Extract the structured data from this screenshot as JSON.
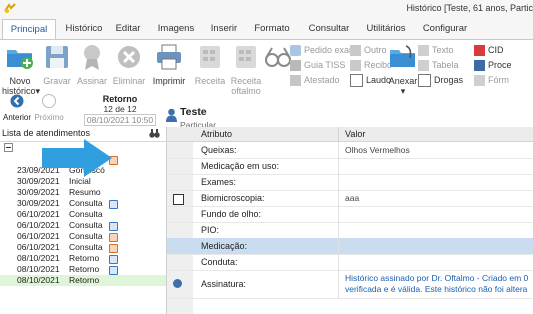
{
  "window": {
    "title": "Histórico [Teste, 61 anos, Partic"
  },
  "tabs": [
    "Principal",
    "Histórico",
    "Editar",
    "Imagens",
    "Inserir",
    "Formato",
    "Consultar",
    "Utilitários",
    "Configurar"
  ],
  "ribbon": {
    "novo": "Novo",
    "historico": "histórico",
    "gravar": "Gravar",
    "assinar": "Assinar",
    "eliminar": "Eliminar",
    "imprimir": "Imprimir",
    "receita": "Receita",
    "receita_oftalmo_1": "Receita",
    "receita_oftalmo_2": "oftalmo",
    "pedido_exame": "Pedido exam",
    "outro": "Outro",
    "guia_tiss": "Guia TISS",
    "recibo": "Recibo",
    "atestado": "Atestado",
    "laudo": "Laudo",
    "anexar": "Anexar",
    "texto": "Texto",
    "tabela": "Tabela",
    "drogas": "Drogas",
    "cid": "CID",
    "proce": "Proce",
    "form": "Fórm"
  },
  "nav": {
    "anterior": "Anterior",
    "proximo": "Próximo",
    "current_type": "Retorno",
    "current_date": "12 de 12",
    "current_time": "08/10/2021 10:50"
  },
  "patient": {
    "name": "Teste",
    "type": "Particular"
  },
  "left_panel": {
    "header": "Lista de atendimentos",
    "rows": [
      {
        "date": "",
        "type": "Consulta",
        "icon": "orange"
      },
      {
        "date": "23/09/2021",
        "type": "Gonioscó",
        "icon": ""
      },
      {
        "date": "30/09/2021",
        "type": "Inicial",
        "icon": ""
      },
      {
        "date": "30/09/2021",
        "type": "Resumo",
        "icon": ""
      },
      {
        "date": "30/09/2021",
        "type": "Consulta",
        "icon": "blue"
      },
      {
        "date": "06/10/2021",
        "type": "Consulta",
        "icon": ""
      },
      {
        "date": "06/10/2021",
        "type": "Consulta",
        "icon": "blue"
      },
      {
        "date": "06/10/2021",
        "type": "Consulta",
        "icon": "orange"
      },
      {
        "date": "06/10/2021",
        "type": "Consulta",
        "icon": "orange"
      },
      {
        "date": "08/10/2021",
        "type": "Retorno",
        "icon": "blue"
      },
      {
        "date": "08/10/2021",
        "type": "Retorno",
        "icon": "blue"
      },
      {
        "date": "08/10/2021",
        "type": "Retorno",
        "icon": ""
      }
    ]
  },
  "right_panel": {
    "col_attr": "Atributo",
    "col_val": "Valor",
    "rows": [
      {
        "attr": "Queixas:",
        "val": "Olhos Vermelhos"
      },
      {
        "attr": "Medicação em uso:",
        "val": ""
      },
      {
        "attr": "Exames:",
        "val": ""
      },
      {
        "attr": "Biomicroscopia:",
        "val": "aaa"
      },
      {
        "attr": "Fundo de olho:",
        "val": ""
      },
      {
        "attr": "PIO:",
        "val": ""
      },
      {
        "attr": "Medicação:",
        "val": ""
      },
      {
        "attr": "Conduta:",
        "val": ""
      },
      {
        "attr": "Assinatura:",
        "val": "Histórico assinado por Dr. Oftalmo - Criado em 0",
        "val2": "verificada e é válida. Este histórico não foi altera"
      }
    ]
  }
}
